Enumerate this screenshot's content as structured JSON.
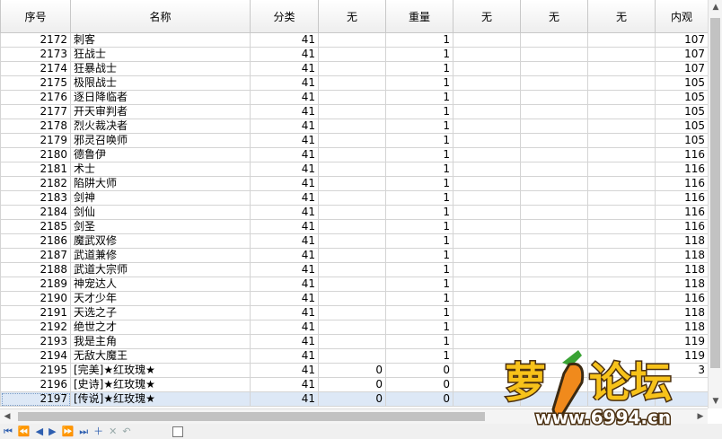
{
  "columns": [
    "序号",
    "名称",
    "分类",
    "无",
    "重量",
    "无",
    "无",
    "无",
    "内观"
  ],
  "rows": [
    [
      "2172",
      "刺客",
      "41",
      "",
      "1",
      "",
      "",
      "",
      "107"
    ],
    [
      "2173",
      "狂战士",
      "41",
      "",
      "1",
      "",
      "",
      "",
      "107"
    ],
    [
      "2174",
      "狂暴战士",
      "41",
      "",
      "1",
      "",
      "",
      "",
      "107"
    ],
    [
      "2175",
      "极限战士",
      "41",
      "",
      "1",
      "",
      "",
      "",
      "105"
    ],
    [
      "2176",
      "逐日降临者",
      "41",
      "",
      "1",
      "",
      "",
      "",
      "105"
    ],
    [
      "2177",
      "开天审判者",
      "41",
      "",
      "1",
      "",
      "",
      "",
      "105"
    ],
    [
      "2178",
      "烈火裁决者",
      "41",
      "",
      "1",
      "",
      "",
      "",
      "105"
    ],
    [
      "2179",
      "邪灵召唤师",
      "41",
      "",
      "1",
      "",
      "",
      "",
      "105"
    ],
    [
      "2180",
      "德鲁伊",
      "41",
      "",
      "1",
      "",
      "",
      "",
      "116"
    ],
    [
      "2181",
      "术士",
      "41",
      "",
      "1",
      "",
      "",
      "",
      "116"
    ],
    [
      "2182",
      "陷阱大师",
      "41",
      "",
      "1",
      "",
      "",
      "",
      "116"
    ],
    [
      "2183",
      "剑神",
      "41",
      "",
      "1",
      "",
      "",
      "",
      "116"
    ],
    [
      "2184",
      "剑仙",
      "41",
      "",
      "1",
      "",
      "",
      "",
      "116"
    ],
    [
      "2185",
      "剑圣",
      "41",
      "",
      "1",
      "",
      "",
      "",
      "116"
    ],
    [
      "2186",
      "魔武双修",
      "41",
      "",
      "1",
      "",
      "",
      "",
      "118"
    ],
    [
      "2187",
      "武道兼修",
      "41",
      "",
      "1",
      "",
      "",
      "",
      "118"
    ],
    [
      "2188",
      "武道大宗师",
      "41",
      "",
      "1",
      "",
      "",
      "",
      "118"
    ],
    [
      "2189",
      "神宠达人",
      "41",
      "",
      "1",
      "",
      "",
      "",
      "118"
    ],
    [
      "2190",
      "天才少年",
      "41",
      "",
      "1",
      "",
      "",
      "",
      "116"
    ],
    [
      "2191",
      "天选之子",
      "41",
      "",
      "1",
      "",
      "",
      "",
      "118"
    ],
    [
      "2192",
      "绝世之才",
      "41",
      "",
      "1",
      "",
      "",
      "",
      "118"
    ],
    [
      "2193",
      "我是主角",
      "41",
      "",
      "1",
      "",
      "",
      "",
      "119"
    ],
    [
      "2194",
      "无敌大魔王",
      "41",
      "",
      "1",
      "",
      "",
      "",
      "119"
    ],
    [
      "2195",
      "[完美]★红玫瑰★",
      "41",
      "0",
      "0",
      "",
      "",
      "",
      "3"
    ],
    [
      "2196",
      "[史诗]★红玫瑰★",
      "41",
      "0",
      "0",
      "",
      "",
      "",
      ""
    ],
    [
      "2197",
      "[传说]★红玫瑰★",
      "41",
      "0",
      "0",
      "",
      "",
      "",
      ""
    ]
  ],
  "selected_row": 25,
  "watermark": {
    "brand": "萝卜论坛",
    "url": "www.6994.cn"
  },
  "icons": [
    "first-record-icon",
    "prev-page-icon",
    "prev-record-icon",
    "next-record-icon",
    "next-page-icon",
    "last-record-icon",
    "add-record-icon",
    "delete-record-icon",
    "cancel-edit-icon"
  ]
}
